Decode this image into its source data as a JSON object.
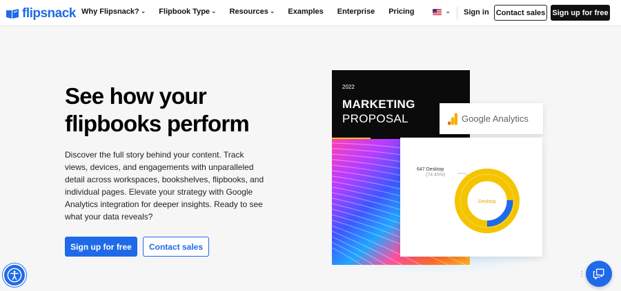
{
  "nav": {
    "logo": "flipsnack",
    "items": [
      {
        "label": "Why Flipsnack?",
        "dropdown": true
      },
      {
        "label": "Flipbook Type",
        "dropdown": true
      },
      {
        "label": "Resources",
        "dropdown": true
      },
      {
        "label": "Examples",
        "dropdown": false
      },
      {
        "label": "Enterprise",
        "dropdown": false
      },
      {
        "label": "Pricing",
        "dropdown": false
      }
    ],
    "language_icon": "us-flag-icon",
    "signin": "Sign in",
    "contact_sales": "Contact sales",
    "signup": "Sign up for free"
  },
  "hero": {
    "title_line1": "See how your",
    "title_line2": "flipbooks perform",
    "description": "Discover the full story behind your content. Track views, devices, and engagements with unparalleled detail across workspaces, bookshelves, flipbooks, and individual pages. Elevate your strategy with Google Analytics integration for deeper insights. Ready to see what your data reveals?",
    "cta_primary": "Sign up for free",
    "cta_secondary": "Contact sales"
  },
  "illustration": {
    "book_year": "2022",
    "book_title_bold": "MARKETING",
    "book_title_light": "PROPOSAL",
    "ga_label": "Google Analytics",
    "chart_callout": "647 Desktop",
    "chart_callout_pct": "(74.45%)",
    "chart_center": "Desktop",
    "chart_share": 74.45
  },
  "colors": {
    "brand_blue": "#1f6ae8",
    "ga_yellow": "#f5b400",
    "ga_orange": "#e8710a"
  }
}
